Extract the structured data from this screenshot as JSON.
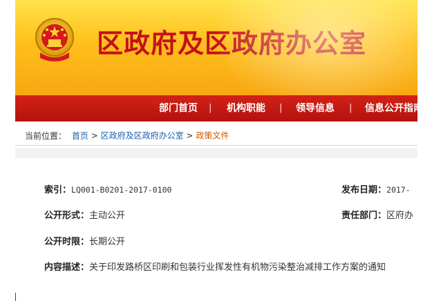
{
  "header": {
    "title": "区政府及区政府办公室",
    "emblem_icon": "national-emblem-icon",
    "colors": {
      "banner": "#ffc21f",
      "title": "#c4101a",
      "nav": "#c2180f"
    }
  },
  "nav": {
    "items": [
      {
        "label": "部门首页"
      },
      {
        "label": "机构职能"
      },
      {
        "label": "领导信息"
      },
      {
        "label": "信息公开指南"
      }
    ],
    "separator": "|"
  },
  "breadcrumb": {
    "prefix": "当前位置：",
    "items": [
      "首页",
      "区政府及区政府办公室",
      "政策文件"
    ],
    "separator": ">"
  },
  "meta": {
    "index_label": "索引：",
    "index_value": "LQ001-B0201-2017-0100",
    "publish_date_label": "发布日期：",
    "publish_date_value": "2017-",
    "open_form_label": "公开形式：",
    "open_form_value": "主动公开",
    "dept_label": "责任部门：",
    "dept_value": "区府办",
    "open_period_label": "公开时限：",
    "open_period_value": "长期公开",
    "description_label": "内容描述：",
    "description_value": "关于印发路桥区印刷和包装行业挥发性有机物污染整治减排工作方案的通知"
  }
}
